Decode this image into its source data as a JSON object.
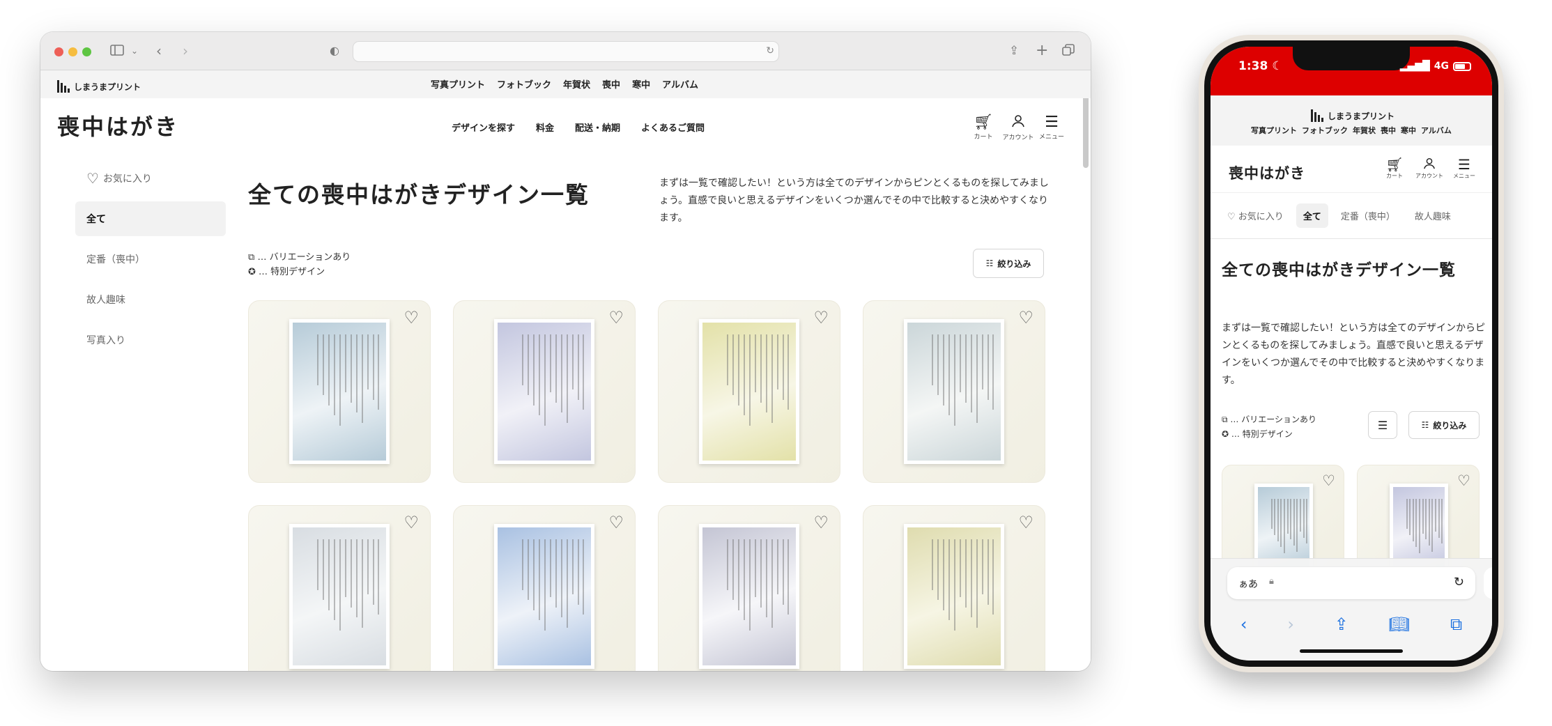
{
  "browser": {
    "icons": [
      "sidebar-icon",
      "chevron-down-icon",
      "back-icon",
      "forward-icon",
      "privacy-shield-icon",
      "reload-icon",
      "share-icon",
      "new-tab-icon",
      "tab-overview-icon"
    ]
  },
  "site": {
    "brand": "しまうまプリント",
    "top_nav": [
      "写真プリント",
      "フォトブック",
      "年賀状",
      "喪中",
      "寒中",
      "アルバム"
    ],
    "title": "喪中はがき",
    "main_nav": [
      "デザインを探す",
      "料金",
      "配送・納期",
      "よくあるご質問"
    ],
    "header_icons": {
      "cart": "カート",
      "account": "アカウント",
      "menu": "メニュー"
    }
  },
  "sidebar": {
    "favorites": "お気に入り",
    "items": [
      "全て",
      "定番（喪中）",
      "故人趣味",
      "写真入り"
    ],
    "active": "全て"
  },
  "main": {
    "title": "全ての喪中はがきデザイン一覧",
    "description": "まずは一覧で確認したい！という方は全てのデザインからピンとくるものを探してみましょう。直感で良いと思えるデザインをいくつか選んでその中で比較すると決めやすくなります。",
    "legend": {
      "variation": "… バリエーションあり",
      "special": "… 特別デザイン"
    },
    "filter_label": "絞り込み",
    "card_colors": [
      [
        "#b6cbd8",
        "#eef3f6"
      ],
      [
        "#c3c6df",
        "#f1f1f7"
      ],
      [
        "#e3e1a8",
        "#f7f6e6"
      ],
      [
        "#cbd6d9",
        "#f4f6f5"
      ],
      [
        "#d8dde2",
        "#f4f6f7"
      ],
      [
        "#a9c1e2",
        "#eef2f8"
      ],
      [
        "#c4c5d4",
        "#f6f6f9"
      ],
      [
        "#dfdcaf",
        "#f6f5e4"
      ]
    ]
  },
  "phone": {
    "time": "1:38",
    "network": "4G",
    "tabs": [
      "お気に入り",
      "全て",
      "定番（喪中）",
      "故人趣味"
    ],
    "address_text": "ぁあ",
    "accent": "#dd0000"
  }
}
